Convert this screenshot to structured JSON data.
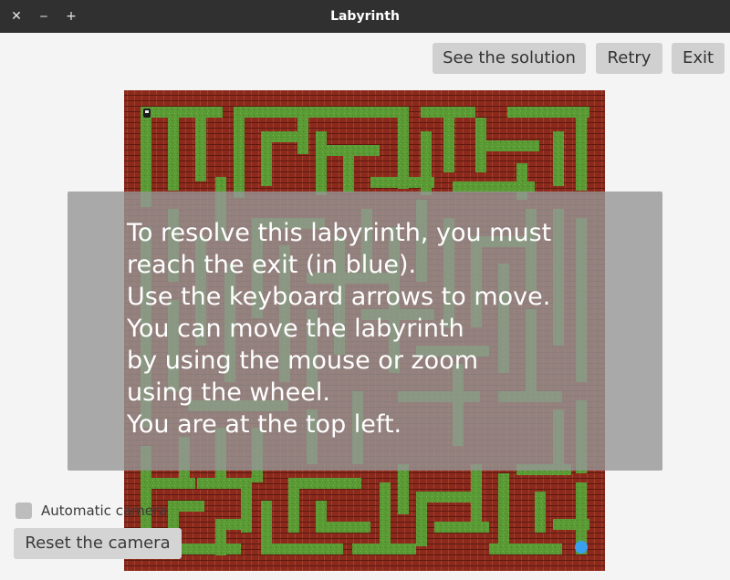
{
  "window": {
    "title": "Labyrinth",
    "controls": {
      "close": "✕",
      "minimize": "‒",
      "maximize": "+"
    }
  },
  "toolbar": {
    "solution_label": "See the solution",
    "retry_label": "Retry",
    "exit_label": "Exit"
  },
  "maze": {
    "wall_color": "#8b2a1c",
    "path_color": "#5a9a35",
    "exit_color": "#3aa0ee",
    "player_icon": "player-icon",
    "exit_icon": "exit-marker"
  },
  "overlay": {
    "lines": [
      "To resolve this labyrinth, you must",
      "reach the exit (in blue).",
      "Use the keyboard arrows to move.",
      "You can move the labyrinth",
      "by using the mouse or zoom",
      "using the wheel.",
      "You are at the top left."
    ]
  },
  "camera": {
    "automatic_label": "Automatic camera",
    "automatic_checked": false,
    "reset_label": "Reset the camera"
  }
}
